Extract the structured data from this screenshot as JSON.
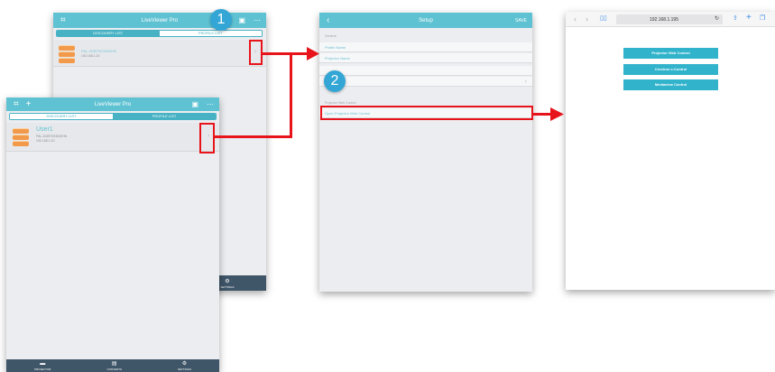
{
  "app": {
    "title": "LiveViewer Pro",
    "tabs": [
      "DISCOVERY LIST",
      "PROFILE LIST"
    ],
    "discovery_device": {
      "name": "PAL-3OBT9O3000HN",
      "ip": "192.168.1.20"
    },
    "profile_device": {
      "name": "User1",
      "id": "PAL-3OBT9O3000HN",
      "ip": "192.168.1.20"
    },
    "bottom_tabs": [
      "PROJECTOR",
      "CONTENTS",
      "SETTINGS"
    ]
  },
  "setup": {
    "title": "Setup",
    "save": "SAVE",
    "section_general": "General",
    "profile_name_placeholder": "Profile Name",
    "projector_name_placeholder": "Projector Name",
    "section_web": "Projector Web Control",
    "open_web_control": "Open Projector Web Control"
  },
  "browser": {
    "url": "192.168.1.195",
    "buttons": [
      "Projector Web Control",
      "Crestron e-Control",
      "Mediaview Control"
    ]
  },
  "callouts": {
    "one": "1",
    "two": "2"
  },
  "colors": {
    "accent": "#5fc2d2",
    "highlight": "#e8141b",
    "badge": "#33a6d6",
    "tabbar": "#3f5568"
  }
}
